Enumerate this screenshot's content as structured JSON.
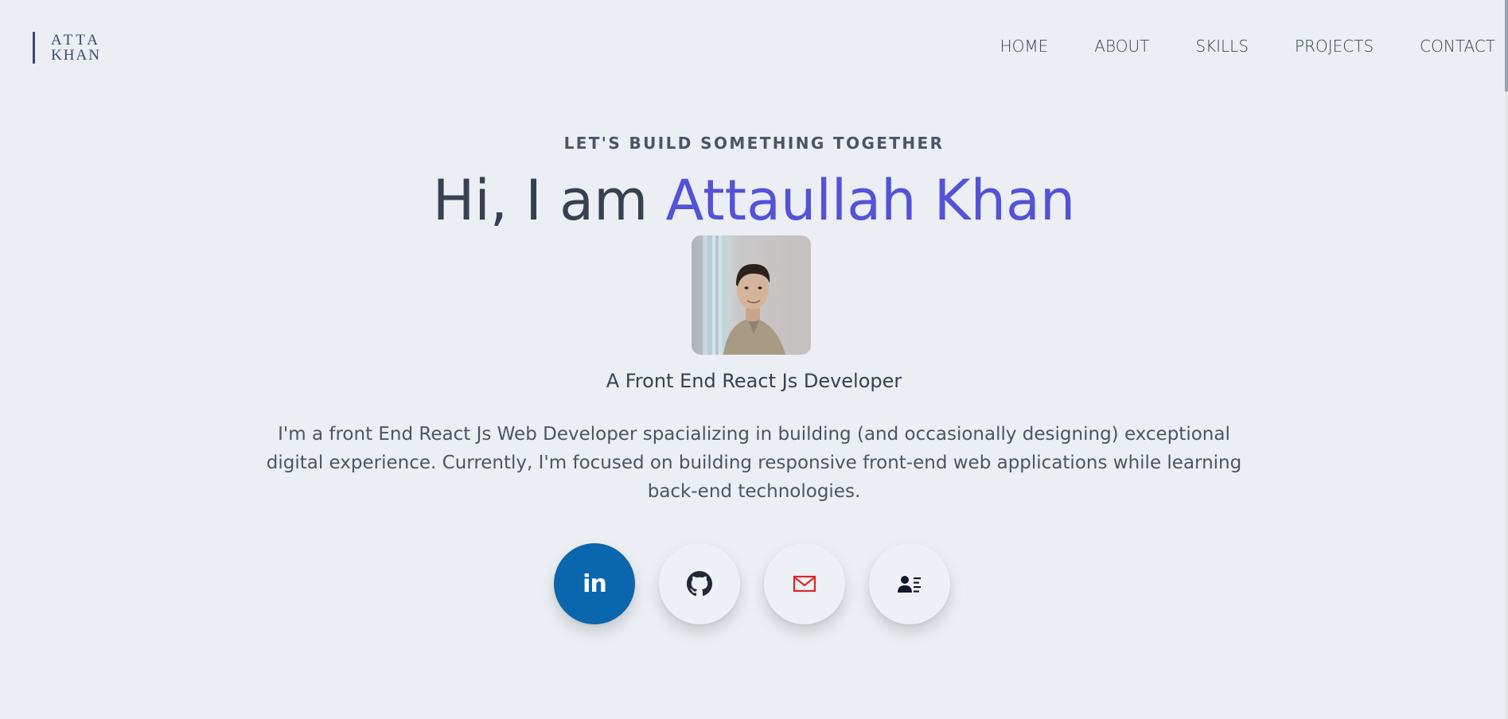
{
  "header": {
    "logo": {
      "line1": "ATTA",
      "line2": "KHAN"
    },
    "nav": [
      "HOME",
      "ABOUT",
      "SKILLS",
      "PROJECTS",
      "CONTACT"
    ]
  },
  "hero": {
    "tagline": "LET'S BUILD SOMETHING TOGETHER",
    "greeting": "Hi, I am ",
    "name": "Attaullah Khan",
    "avatar_icon": "profile-photo",
    "role": "A Front End React Js Developer",
    "bio": "I'm a front End React Js Web Developer spacializing in building (and occasionally designing) exceptional digital experience. Currently, I'm focused on building responsive front-end web applications while learning back-end technologies."
  },
  "socials": [
    {
      "icon": "linkedin-icon",
      "label": "in"
    },
    {
      "icon": "github-icon"
    },
    {
      "icon": "mail-icon"
    },
    {
      "icon": "contact-card-icon"
    }
  ],
  "colors": {
    "background": "#ebeef2",
    "text": "#374151",
    "accent": "#5353d6",
    "linkedin": "#0a66ad",
    "mail": "#dc2626",
    "logo": "#3b4a6b"
  }
}
